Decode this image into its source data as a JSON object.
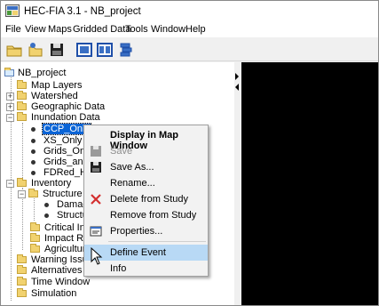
{
  "window": {
    "title": "HEC-FIA 3.1 - NB_project"
  },
  "menubar": {
    "items": [
      "File",
      "View",
      "Maps",
      "Gridded Data",
      "Tools",
      "Window",
      "Help"
    ]
  },
  "toolbar": {
    "buttons": [
      "open-folder-icon",
      "open-study-icon",
      "save-icon",
      "map-icon",
      "map-layers-icon",
      "layers-stack-icon"
    ]
  },
  "tree": {
    "root": "NB_project",
    "map_layers": "Map Layers",
    "watershed": "Watershed",
    "geographic_data": "Geographic Data",
    "inundation_data": "Inundation Data",
    "ccp_only": "CCP_Only",
    "xs_only": "XS_Only",
    "grids_onl": "Grids_Onl",
    "grids_and": "Grids_and",
    "fdred_h": "FDRed_H",
    "inventory": "Inventory",
    "structure_i": "Structure I",
    "damag": "Damag",
    "structu": "Structu",
    "critical_infr": "Critical Infr",
    "impact_re": "Impact Re",
    "agricultura": "Agricultura",
    "warning_issua": "Warning Issua",
    "alternatives": "Alternatives",
    "time_window": "Time Window",
    "simulation": "Simulation"
  },
  "context_menu": {
    "display_in_map_window": "Display in Map Window",
    "save": "Save",
    "save_as": "Save As...",
    "rename": "Rename...",
    "delete_from_study": "Delete from Study",
    "remove_from_study": "Remove from Study",
    "properties": "Properties...",
    "define_event": "Define Event",
    "info": "Info"
  },
  "colors": {
    "selection": "#0a64d6",
    "hover": "#b8d9f5",
    "folder": "#f1d26f",
    "map_background": "#000000",
    "delete_icon": "#d32f2f"
  }
}
